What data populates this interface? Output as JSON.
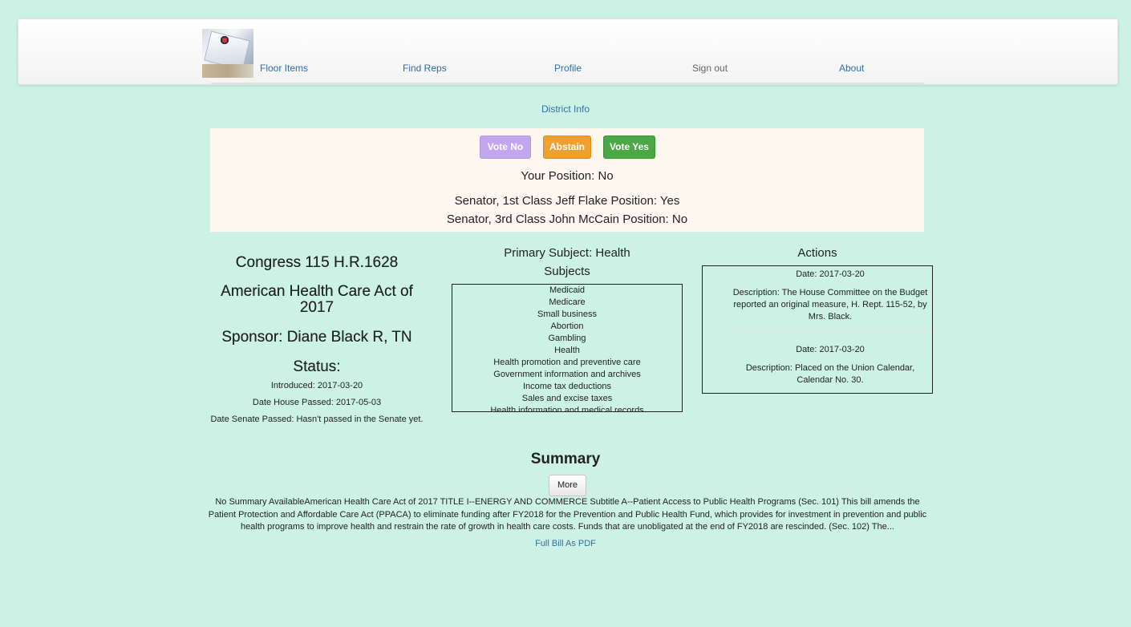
{
  "nav": {
    "items": [
      {
        "label": "Floor Items"
      },
      {
        "label": "Find Reps"
      },
      {
        "label": "Profile"
      },
      {
        "label": "Sign out"
      },
      {
        "label": "About"
      }
    ],
    "logo_icon": "ballot-box-logo"
  },
  "district_link": "District Info",
  "vote": {
    "no_label": "Vote No",
    "abstain_label": "Abstain",
    "yes_label": "Vote Yes",
    "your_position": "Your Position: No",
    "senator1": "Senator, 1st Class Jeff Flake Position: Yes",
    "senator3": "Senator, 3rd Class John McCain Position: No",
    "colors": {
      "no": "#c3a6f0",
      "abstain": "#f0a030",
      "yes": "#4aa845"
    }
  },
  "bill": {
    "congress": "Congress 115 H.R.1628",
    "title": "American Health Care Act of 2017",
    "sponsor": "Sponsor: Diane Black R, TN",
    "status_heading": "Status:",
    "introduced": "Introduced: 2017-03-20",
    "house_passed": "Date House Passed: 2017-05-03",
    "senate_passed": "Date Senate Passed: Hasn't passed in the Senate yet."
  },
  "subjects": {
    "primary": "Primary Subject: Health",
    "heading": "Subjects",
    "items": [
      "Medicaid",
      "Medicare",
      "Small business",
      "Abortion",
      "Gambling",
      "Health",
      "Health promotion and preventive care",
      "Government information and archives",
      "Income tax deductions",
      "Sales and excise taxes",
      "Health information and medical records"
    ]
  },
  "actions": {
    "heading": "Actions",
    "items": [
      {
        "date": "Date: 2017-03-20",
        "description": "Description: The House Committee on the Budget reported an original measure, H. Rept. 115-52, by Mrs. Black."
      },
      {
        "date": "Date: 2017-03-20",
        "description": "Description: Placed on the Union Calendar, Calendar No. 30."
      }
    ]
  },
  "summary": {
    "heading": "Summary",
    "more_label": "More",
    "text": "No Summary AvailableAmerican Health Care Act of 2017 TITLE I--ENERGY AND COMMERCE Subtitle A--Patient Access to Public Health Programs (Sec. 101) This bill amends the Patient Protection and Affordable Care Act (PPACA) to eliminate funding after FY2018 for the Prevention and Public Health Fund, which provides for investment in prevention and public health programs to improve health and restrain the rate of growth in health care costs. Funds that are unobligated at the end of FY2018 are rescinded. (Sec. 102) The...",
    "pdf_link": "Full Bill As PDF"
  }
}
